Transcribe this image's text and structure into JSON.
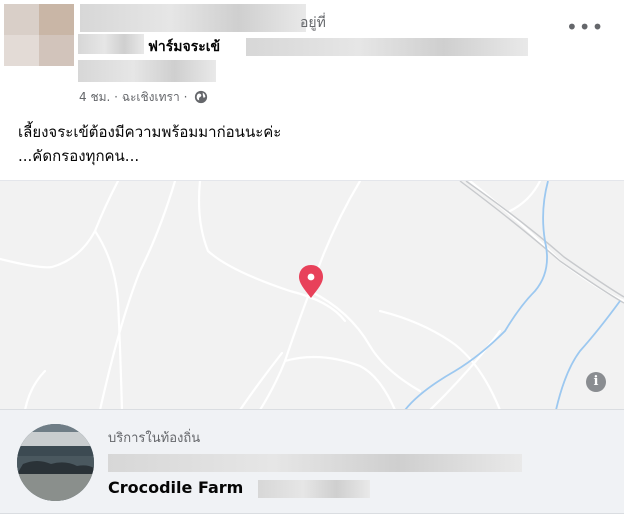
{
  "post": {
    "title_suffix": "อยู่ที่",
    "title_line2": "ฟาร์มจระเข้",
    "meta": {
      "time": "4 ชม.",
      "separator": "·",
      "location": "ฉะเชิงเทรา",
      "separator2": "·",
      "audience_icon": "globe-icon"
    },
    "more_label": "•••",
    "message_lines": [
      "เลี้ยงจระเข้ต้องมีความพร้อมมาก่อนนะค่ะ",
      "...คัดกรองทุกคน..."
    ]
  },
  "map": {
    "pin_icon": "map-pin-icon",
    "info_label": "i",
    "colors": {
      "background": "#f2f2f2",
      "roads": "#ffffff",
      "river": "#9cc8f0",
      "pin": "#e8415a"
    }
  },
  "place": {
    "category": "บริการในท้องถิ่น",
    "name": "Crocodile Farm"
  }
}
